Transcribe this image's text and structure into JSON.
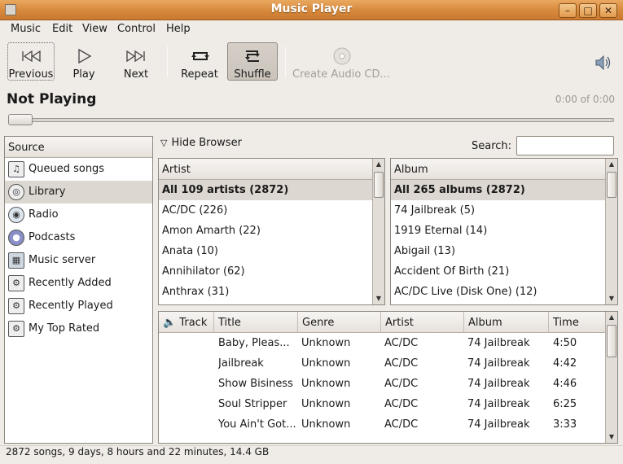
{
  "window": {
    "title": "Music Player",
    "buttons": {
      "minimize": "–",
      "maximize": "□",
      "close": "✕"
    }
  },
  "menu": [
    "Music",
    "Edit",
    "View",
    "Control",
    "Help"
  ],
  "toolbar": {
    "previous": "Previous",
    "play": "Play",
    "next": "Next",
    "repeat": "Repeat",
    "shuffle": "Shuffle",
    "create_cd": "Create Audio CD..."
  },
  "now_playing": "Not Playing",
  "time_readout": "0:00 of 0:00",
  "sources": {
    "header": "Source",
    "items": [
      {
        "label": "Queued songs",
        "icon": "queue-icon"
      },
      {
        "label": "Library",
        "icon": "library-icon"
      },
      {
        "label": "Radio",
        "icon": "radio-icon"
      },
      {
        "label": "Podcasts",
        "icon": "podcast-icon"
      },
      {
        "label": "Music server",
        "icon": "server-icon"
      },
      {
        "label": "Recently Added",
        "icon": "smart-playlist-icon"
      },
      {
        "label": "Recently Played",
        "icon": "smart-playlist-icon"
      },
      {
        "label": "My Top Rated",
        "icon": "smart-playlist-icon"
      }
    ]
  },
  "browser": {
    "hide_label": "Hide Browser",
    "search_label": "Search:",
    "search_value": "",
    "artist": {
      "header": "Artist",
      "rows": [
        "All 109 artists (2872)",
        "AC/DC (226)",
        "Amon Amarth (22)",
        "Anata (10)",
        "Annihilator (62)",
        "Anthrax (31)"
      ]
    },
    "album": {
      "header": "Album",
      "rows": [
        "All 265 albums (2872)",
        "74 Jailbreak (5)",
        "1919 Eternal (14)",
        "Abigail (13)",
        "Accident Of Birth (21)",
        "AC/DC Live (Disk One) (12)"
      ]
    }
  },
  "tracks": {
    "headers": {
      "track": "Track",
      "title": "Title",
      "genre": "Genre",
      "artist": "Artist",
      "album": "Album",
      "time": "Time"
    },
    "rows": [
      {
        "title": "Baby, Pleas...",
        "genre": "Unknown",
        "artist": "AC/DC",
        "album": "74 Jailbreak",
        "time": "4:50"
      },
      {
        "title": "Jailbreak",
        "genre": "Unknown",
        "artist": "AC/DC",
        "album": "74 Jailbreak",
        "time": "4:42"
      },
      {
        "title": "Show Bisiness",
        "genre": "Unknown",
        "artist": "AC/DC",
        "album": "74 Jailbreak",
        "time": "4:46"
      },
      {
        "title": "Soul Stripper",
        "genre": "Unknown",
        "artist": "AC/DC",
        "album": "74 Jailbreak",
        "time": "6:25"
      },
      {
        "title": "You Ain't Got...",
        "genre": "Unknown",
        "artist": "AC/DC",
        "album": "74 Jailbreak",
        "time": "3:33"
      }
    ]
  },
  "status": "2872 songs, 9 days, 8 hours and 22 minutes, 14.4 GB",
  "colors": {
    "titlebar": "#d7883c",
    "selection": "#dcd7d0",
    "window_bg": "#efebe7"
  }
}
